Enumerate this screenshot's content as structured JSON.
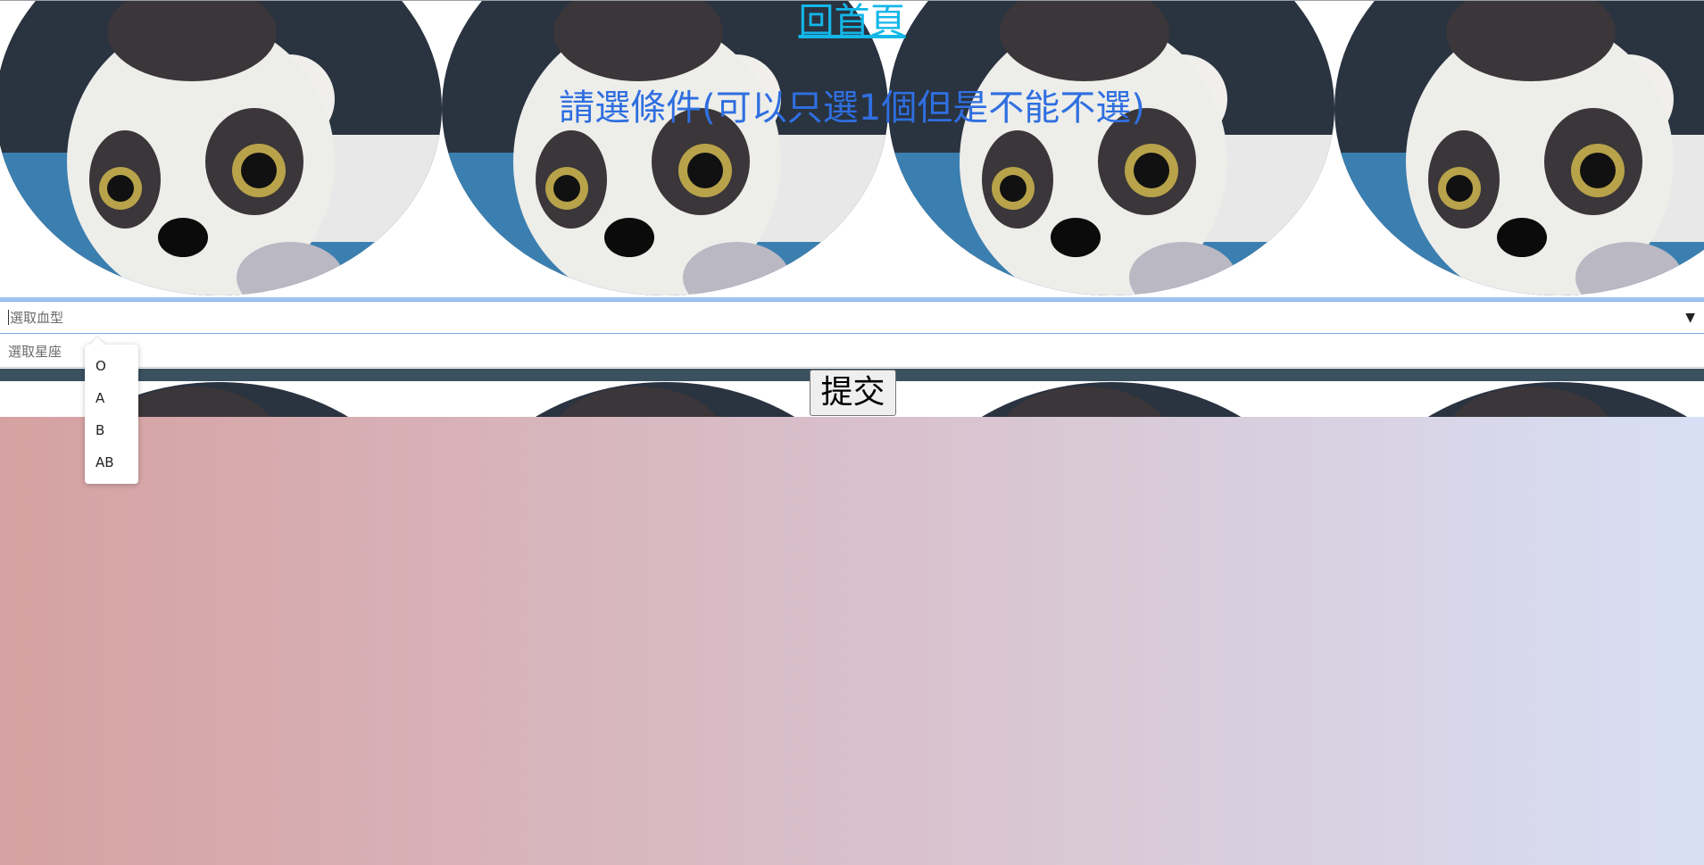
{
  "header": {
    "home_link": "回首頁",
    "prompt": "請選條件(可以只選1個但是不能不選)"
  },
  "form": {
    "blood_type": {
      "placeholder": "選取血型",
      "options": [
        "O",
        "A",
        "B",
        "AB"
      ]
    },
    "zodiac": {
      "placeholder": "選取星座"
    },
    "submit_label": "提交"
  },
  "icons": {
    "dropdown_caret": "▼"
  },
  "colors": {
    "link": "#13b7e8",
    "prompt": "#2f6fe0",
    "gradient_start": "#d6a1a1",
    "gradient_end": "#d8dff4"
  }
}
